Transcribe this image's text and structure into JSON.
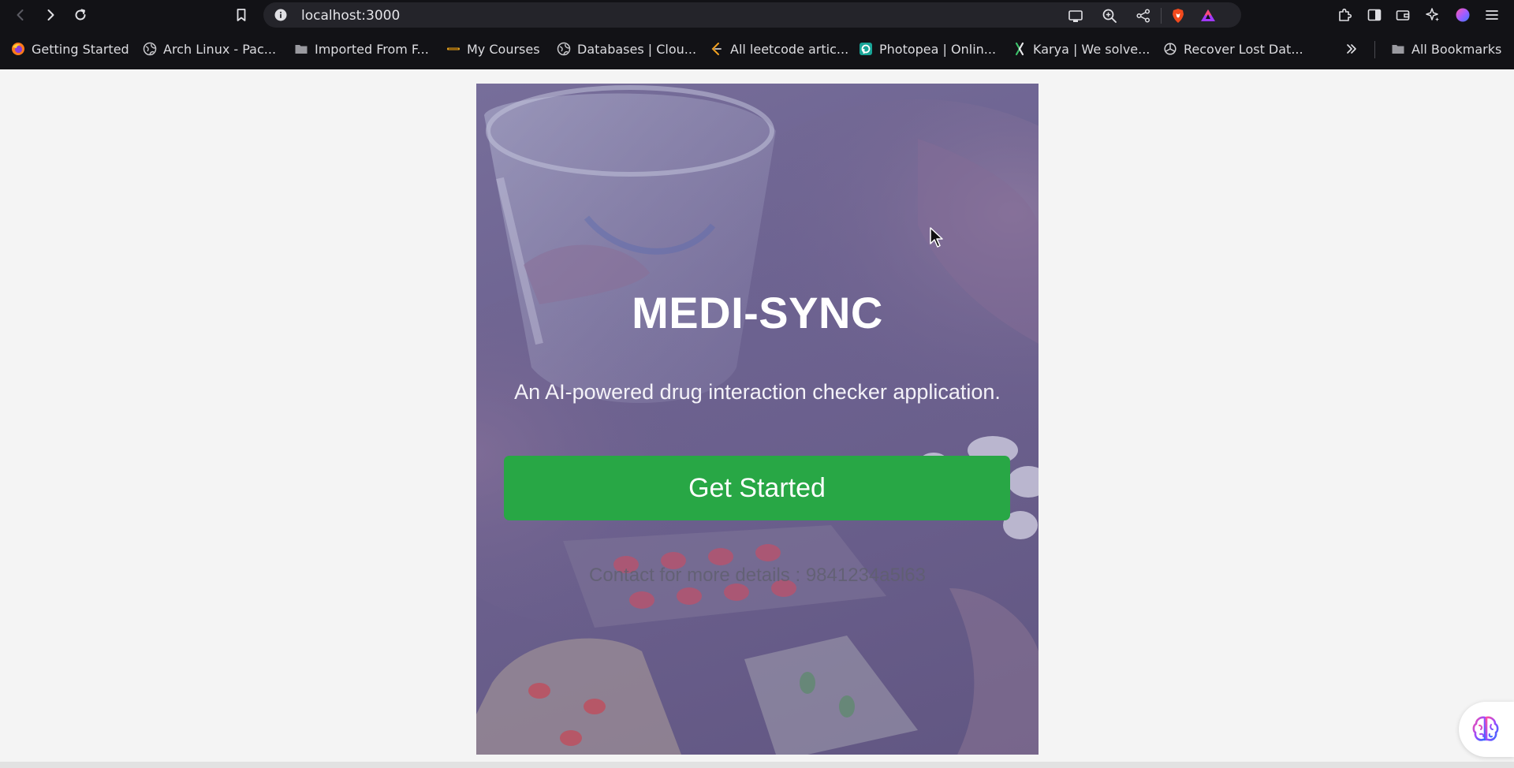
{
  "browser": {
    "url": "localhost:3000",
    "bookmarks": [
      {
        "label": "Getting Started",
        "icon": "firefox-icon"
      },
      {
        "label": "Arch Linux - Pac...",
        "icon": "globe-icon"
      },
      {
        "label": "Imported From F...",
        "icon": "folder-icon"
      },
      {
        "label": "My Courses",
        "icon": "courses-icon"
      },
      {
        "label": "Databases | Clou...",
        "icon": "globe-icon"
      },
      {
        "label": "All leetcode artic...",
        "icon": "leetcode-icon"
      },
      {
        "label": "Photopea | Onlin...",
        "icon": "photopea-icon"
      },
      {
        "label": "Karya | We solve...",
        "icon": "karya-icon"
      },
      {
        "label": "Recover Lost Dat...",
        "icon": "openai-icon"
      }
    ],
    "all_bookmarks_label": "All Bookmarks"
  },
  "hero": {
    "title": "MEDI-SYNC",
    "subtitle": "An AI-powered drug interaction checker application.",
    "cta_label": "Get Started",
    "contact": "Contact for more details : 9841234a5l63"
  },
  "colors": {
    "accent": "#28a745",
    "overlay": "#6a5f8c",
    "chrome": "#121216"
  }
}
